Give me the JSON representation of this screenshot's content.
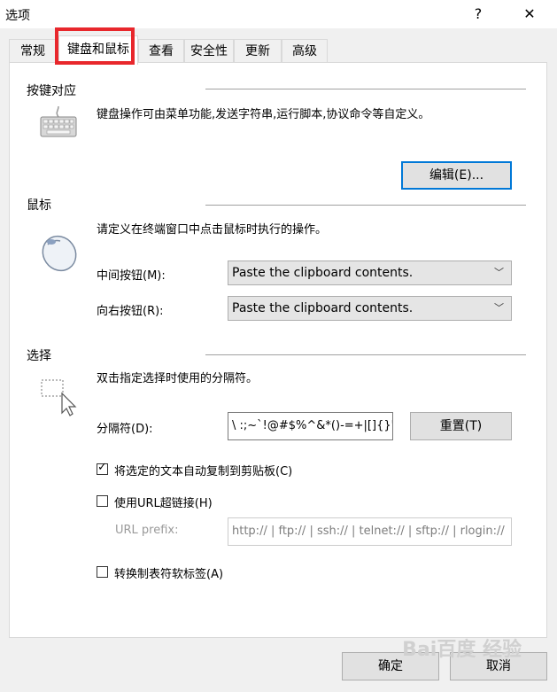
{
  "window": {
    "title": "选项",
    "help": "?",
    "close": "✕"
  },
  "tabs": [
    "常规",
    "键盘和鼠标",
    "查看",
    "安全性",
    "更新",
    "高级"
  ],
  "keyboard": {
    "section": "按键对应",
    "desc": "键盘操作可由菜单功能,发送字符串,运行脚本,协议命令等自定义。",
    "edit_button": "编辑(E)..."
  },
  "mouse": {
    "section": "鼠标",
    "desc": "请定义在终端窗口中点击鼠标时执行的操作。",
    "middle_label": "中间按钮(M):",
    "middle_value": "Paste the clipboard contents.",
    "right_label": "向右按钮(R):",
    "right_value": "Paste the clipboard contents."
  },
  "select": {
    "section": "选择",
    "desc": "双击指定选择时使用的分隔符。",
    "delimiter_label": "分隔符(D):",
    "delimiter_value": "\\ :;~`!@#$%^&*()-=+|[]{}'",
    "reset_button": "重置(T)",
    "auto_copy_label": "将选定的文本自动复制到剪贴板(C)",
    "auto_copy_checked": true,
    "url_label": "使用URL超链接(H)",
    "url_checked": false,
    "url_prefix_label": "URL prefix:",
    "url_prefix_value": "http:// | ftp:// | ssh:// | telnet:// | sftp:// | rlogin://",
    "tab_label": "转换制表符软标签(A)",
    "tab_checked": false
  },
  "footer": {
    "ok": "确定",
    "cancel": "取消"
  },
  "watermark": "Bai百度 经验"
}
